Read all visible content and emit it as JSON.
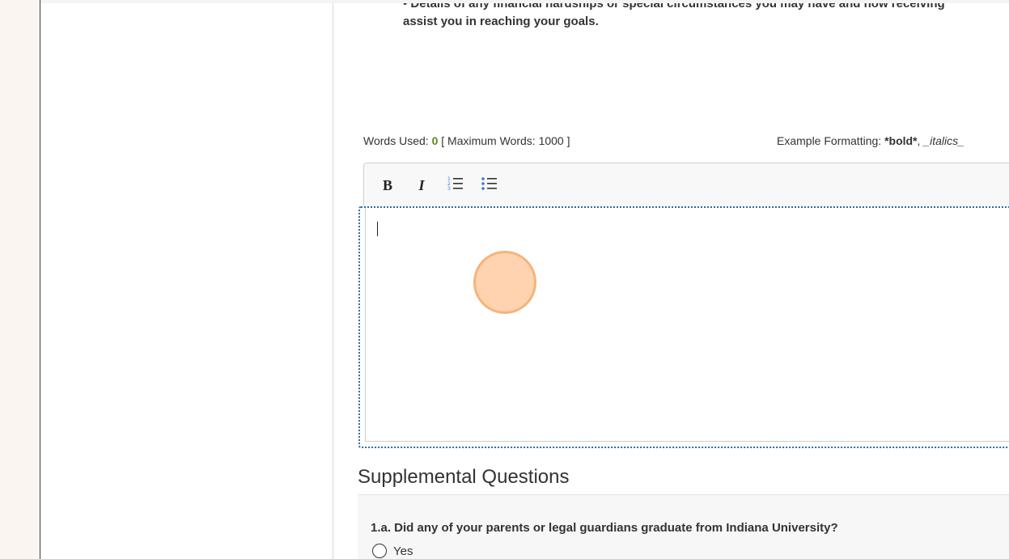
{
  "essay": {
    "intro_cutoff_text": "• Details of any financial hardships or special circumstances you may have and how receiving",
    "intro_line2": "assist you in reaching your goals.",
    "words_used_label": "Words Used:",
    "words_used_value": "0",
    "max_words_text": "[ Maximum Words: 1000 ]",
    "format_label": "Example Formatting:",
    "format_bold": "*bold*",
    "format_sep": ",",
    "format_italics": "_italics_"
  },
  "toolbar": {
    "bold_label": "B",
    "italic_label": "I"
  },
  "supplemental": {
    "title": "Supplemental Questions",
    "question_1a": "1.a. Did any of your parents or legal guardians graduate from Indiana University?",
    "option_yes": "Yes"
  },
  "colors": {
    "word_count_accent": "#5a8a1e",
    "editor_focus_border": "#2a6a9e",
    "click_marker": "#f4b47a"
  }
}
